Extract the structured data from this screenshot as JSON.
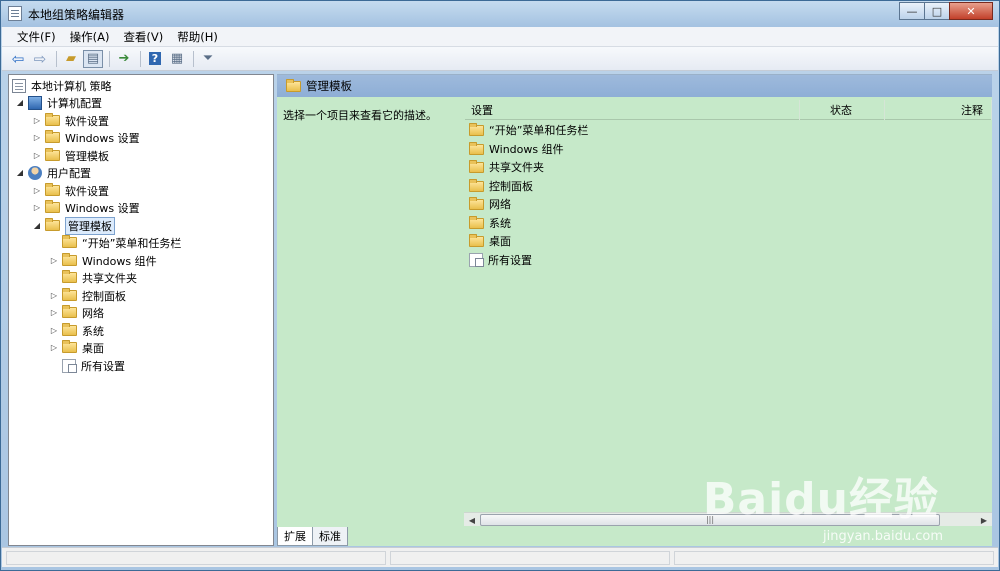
{
  "window": {
    "title": "本地组策略编辑器",
    "buttons": {
      "minimize": "—",
      "maximize": "□",
      "close": "✕"
    }
  },
  "menubar": {
    "items": [
      "文件(F)",
      "操作(A)",
      "查看(V)",
      "帮助(H)"
    ]
  },
  "toolbar": {
    "icons": [
      "back-arrow-icon",
      "forward-arrow-icon",
      "up-folder-icon",
      "show-hide-tree-icon",
      "export-list-icon",
      "help-icon",
      "console-view-icon",
      "filter-icon"
    ]
  },
  "tree": {
    "root": "本地计算机 策略",
    "computer_config": "计算机配置",
    "computer_children": [
      "软件设置",
      "Windows 设置",
      "管理模板"
    ],
    "user_config": "用户配置",
    "user_children": [
      "软件设置",
      "Windows 设置",
      "管理模板"
    ],
    "admin_templates_children": [
      "“开始”菜单和任务栏",
      "Windows 组件",
      "共享文件夹",
      "控制面板",
      "网络",
      "系统",
      "桌面",
      "所有设置"
    ]
  },
  "right_pane": {
    "header": "管理模板",
    "description": "选择一个项目来查看它的描述。",
    "columns": [
      "设置",
      "状态",
      "注释"
    ],
    "items": [
      "“开始”菜单和任务栏",
      "Windows 组件",
      "共享文件夹",
      "控制面板",
      "网络",
      "系统",
      "桌面",
      "所有设置"
    ]
  },
  "tabs": [
    "扩展",
    "标准"
  ],
  "watermark": {
    "logo": "Baidu经验",
    "url": "jingyan.baidu.com"
  },
  "colors": {
    "list_background": "#c6e9c9",
    "header_band": "#9ebadc",
    "title_bar": "#b9d2ea"
  }
}
